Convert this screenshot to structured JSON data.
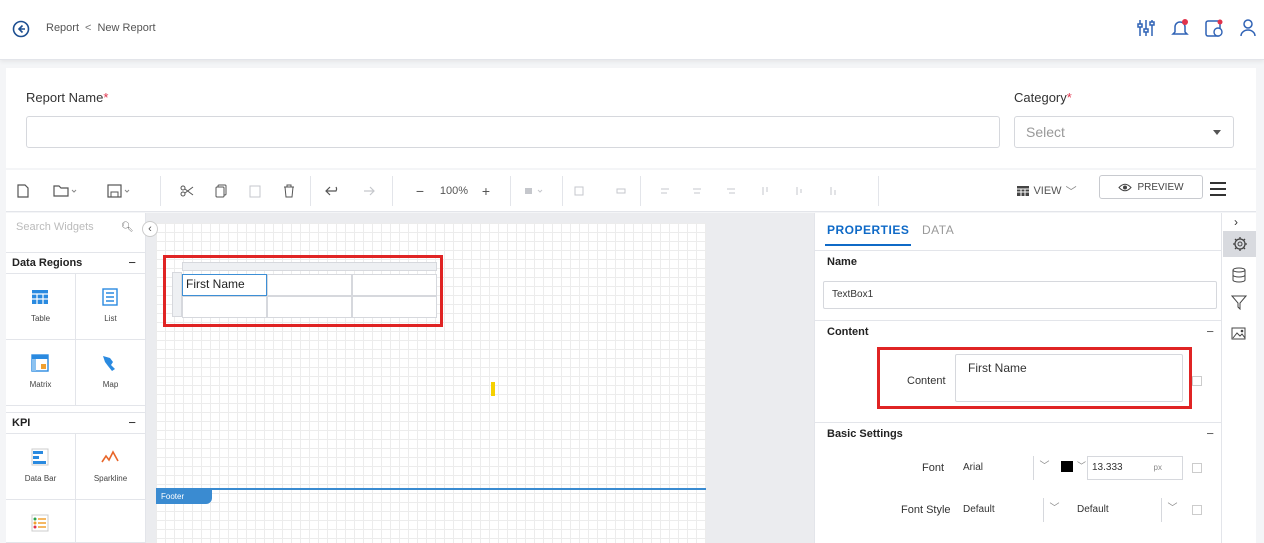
{
  "header": {
    "breadcrumb_root": "Report",
    "breadcrumb_sep": "<",
    "breadcrumb_current": "New Report",
    "icons": [
      "settings-sliders-icon",
      "notification-bell-icon",
      "calendar-icon",
      "user-icon"
    ]
  },
  "form": {
    "report_name_label": "Report Name",
    "report_name_value": "",
    "category_label": "Category",
    "required_mark": "*",
    "category_placeholder": "Select"
  },
  "toolbar": {
    "zoom": "100%",
    "zoom_minus": "−",
    "zoom_plus": "+",
    "view_label": "VIEW",
    "preview_label": "PREVIEW"
  },
  "sidebar": {
    "search_placeholder": "Search Widgets",
    "groups": [
      {
        "title": "Data Regions",
        "items": [
          "Table",
          "List",
          "Matrix",
          "Map"
        ]
      },
      {
        "title": "KPI",
        "items": [
          "Data Bar",
          "Sparkline",
          ""
        ]
      }
    ]
  },
  "canvas": {
    "cell_text": "First Name",
    "footer_label": "Footer"
  },
  "properties": {
    "tabs": [
      "PROPERTIES",
      "DATA"
    ],
    "name_section": "Name",
    "name_value": "TextBox1",
    "content_section": "Content",
    "content_label": "Content",
    "content_value": "First Name",
    "basic_section": "Basic Settings",
    "font_label": "Font",
    "font_value": "Arial",
    "font_color": "#000000",
    "font_size": "13.333",
    "font_unit": "px",
    "font_style_label": "Font Style",
    "font_style_value": "Default",
    "font_weight_value": "Default"
  },
  "colors": {
    "accent": "#0f6ac7",
    "highlight": "#e02424",
    "footer": "#3a8bd1"
  }
}
